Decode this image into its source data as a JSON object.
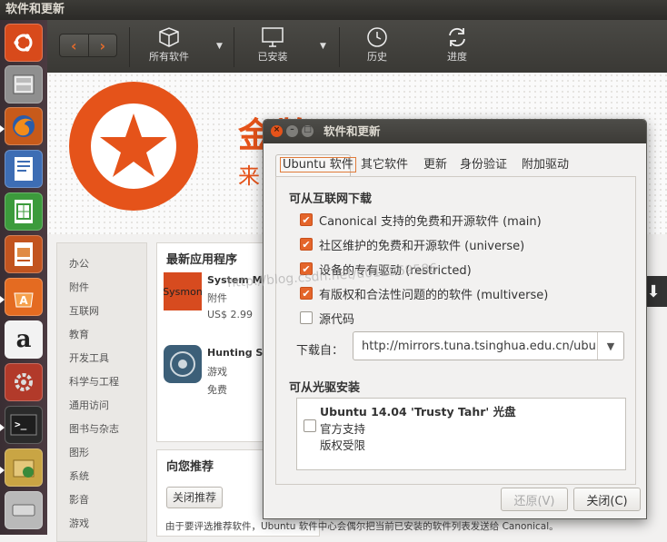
{
  "top_panel": {
    "title": "软件和更新"
  },
  "launcher": {
    "items": [
      {
        "name": "ubuntu-dash-icon"
      },
      {
        "name": "files-icon"
      },
      {
        "name": "firefox-icon"
      },
      {
        "name": "writer-icon"
      },
      {
        "name": "calc-icon"
      },
      {
        "name": "impress-icon"
      },
      {
        "name": "software-center-icon"
      },
      {
        "name": "amazon-icon"
      },
      {
        "name": "system-settings-icon"
      },
      {
        "name": "terminal-icon"
      },
      {
        "name": "software-updater-icon"
      },
      {
        "name": "disk-icon"
      }
    ]
  },
  "toolbar": {
    "back": "‹",
    "forward": "›",
    "all_software": "所有软件",
    "installed": "已安装",
    "history": "历史",
    "progress": "进度"
  },
  "banner": {
    "title": "金牌应用程序",
    "subtitle": "来"
  },
  "categories": [
    "办公",
    "附件",
    "互联网",
    "教育",
    "开发工具",
    "科学与工程",
    "通用访问",
    "图书与杂志",
    "图形",
    "系统",
    "影音",
    "游戏"
  ],
  "new_apps": {
    "title": "最新应用程序",
    "apps": [
      {
        "name": "System Mon",
        "icon_text": "Sysmon",
        "category": "附件",
        "price": "US$ 2.99"
      },
      {
        "name": "Hunting Sta",
        "category": "游戏",
        "price": "免费"
      }
    ]
  },
  "recommend": {
    "title": "向您推荐",
    "close_button": "关闭推荐",
    "description": "由于要评选推荐软件，Ubuntu 软件中心会偶尔把当前已安装的软件列表发送给 Canonical。"
  },
  "watermark": "http://blog.csdn.net/u012969586",
  "dialog": {
    "title": "软件和更新",
    "tabs": [
      "Ubuntu 软件",
      "其它软件",
      "更新",
      "身份验证",
      "附加驱动"
    ],
    "internet_header": "可从互联网下载",
    "sources": [
      {
        "label": "Canonical 支持的免费和开源软件 (main)",
        "checked": true
      },
      {
        "label": "社区维护的免费和开源软件 (universe)",
        "checked": true
      },
      {
        "label": "设备的专有驱动 (restricted)",
        "checked": true
      },
      {
        "label": "有版权和合法性问题的的软件 (multiverse)",
        "checked": true
      },
      {
        "label": "源代码",
        "checked": false
      }
    ],
    "download_from_label": "下载自：",
    "download_from_value": "http://mirrors.tuna.tsinghua.edu.cn/ubuntu",
    "cdrom_header": "可从光驱安装",
    "cdrom": {
      "title": "Ubuntu 14.04 'Trusty Tahr' 光盘",
      "line1": "官方支持",
      "line2": "版权受限",
      "checked": false
    },
    "revert_button": "还原(V)",
    "close_button": "关闭(C)"
  },
  "colors": {
    "accent": "#e4652a",
    "panel": "#3c3b37"
  }
}
